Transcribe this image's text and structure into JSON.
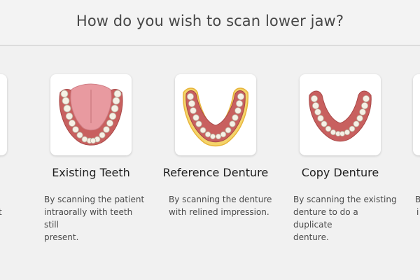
{
  "header": {
    "title": "How do you wish to scan lower jaw?"
  },
  "options": [
    {
      "label": "Existing Teeth",
      "description_lines": [
        "By scanning the patient",
        "intraorally with teeth still",
        "present."
      ],
      "icon": "lower-jaw-with-tongue-icon"
    },
    {
      "label": "Reference Denture",
      "description_lines": [
        "By scanning the denture",
        "with relined impression."
      ],
      "icon": "denture-with-impression-icon"
    },
    {
      "label": "Copy Denture",
      "description_lines": [
        "By scanning the existing",
        "denture to do a duplicate",
        "denture."
      ],
      "icon": "denture-copy-icon"
    }
  ],
  "partial_left": {
    "text_fragment": "t"
  },
  "partial_right": {
    "text_fragments": [
      "B",
      "i"
    ]
  },
  "colors": {
    "gum": "#c8605f",
    "tongue": "#e89aa0",
    "tooth": "#f6f1e6",
    "impression_outline": "#e7b43a"
  }
}
